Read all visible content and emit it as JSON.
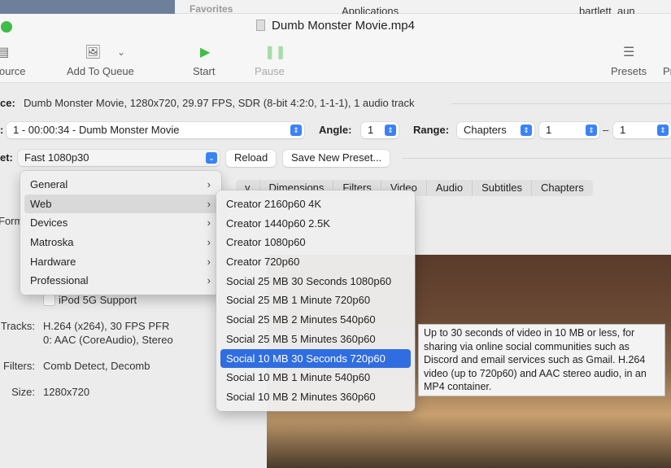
{
  "background": {
    "favorites": "Favorites",
    "applications": "Applications",
    "file": "bartlett_aun"
  },
  "window": {
    "title": "Dumb Monster Movie.mp4"
  },
  "toolbar": {
    "source": "ource",
    "add_to_queue": "Add To Queue",
    "start": "Start",
    "pause": "Pause",
    "presets": "Presets",
    "preview": "Pr"
  },
  "source": {
    "label": "ce:",
    "value": "Dumb Monster Movie, 1280x720, 29.97 FPS, SDR (8-bit 4:2:0, 1-1-1), 1 audio track"
  },
  "title_row": {
    "label": ":",
    "title": "1 - 00:00:34 - Dumb Monster Movie",
    "angle_label": "Angle:",
    "angle": "1",
    "range_label": "Range:",
    "range_type": "Chapters",
    "range_start": "1",
    "range_sep": "–",
    "range_end": "1"
  },
  "preset_row": {
    "label": "et:",
    "preset": "Fast 1080p30",
    "reload": "Reload",
    "save_new": "Save New Preset..."
  },
  "tabs": [
    "y",
    "Dimensions",
    "Filters",
    "Video",
    "Audio",
    "Subtitles",
    "Chapters"
  ],
  "summary": {
    "format_label": "Form",
    "ipod": "iPod 5G Support",
    "tracks_label": "Tracks:",
    "tracks": [
      "H.264 (x264), 30 FPS PFR",
      "0: AAC (CoreAudio), Stereo"
    ],
    "filters_label": "Filters:",
    "filters": "Comb Detect, Decomb",
    "size_label": "Size:",
    "size": "1280x720"
  },
  "preset_menu": {
    "categories": [
      "General",
      "Web",
      "Devices",
      "Matroska",
      "Hardware",
      "Professional"
    ],
    "hovered": "Web"
  },
  "web_submenu": {
    "items": [
      "Creator 2160p60 4K",
      "Creator 1440p60 2.5K",
      "Creator 1080p60",
      "Creator 720p60",
      "Social 25 MB 30 Seconds 1080p60",
      "Social 25 MB 1 Minute 720p60",
      "Social 25 MB 2 Minutes 540p60",
      "Social 25 MB 5 Minutes 360p60",
      "Social 10 MB 30 Seconds 720p60",
      "Social 10 MB 1 Minute 540p60",
      "Social 10 MB 2 Minutes 360p60"
    ],
    "selected": "Social 10 MB 30 Seconds 720p60"
  },
  "tooltip": "Up to 30 seconds of video in 10 MB or less, for sharing via online social communities such as Discord and email services such as Gmail. H.264 video (up to 720p60) and AAC stereo audio, in an MP4 container.",
  "colors": {
    "accent": "#2f6de0",
    "start": "#3fbd47"
  }
}
